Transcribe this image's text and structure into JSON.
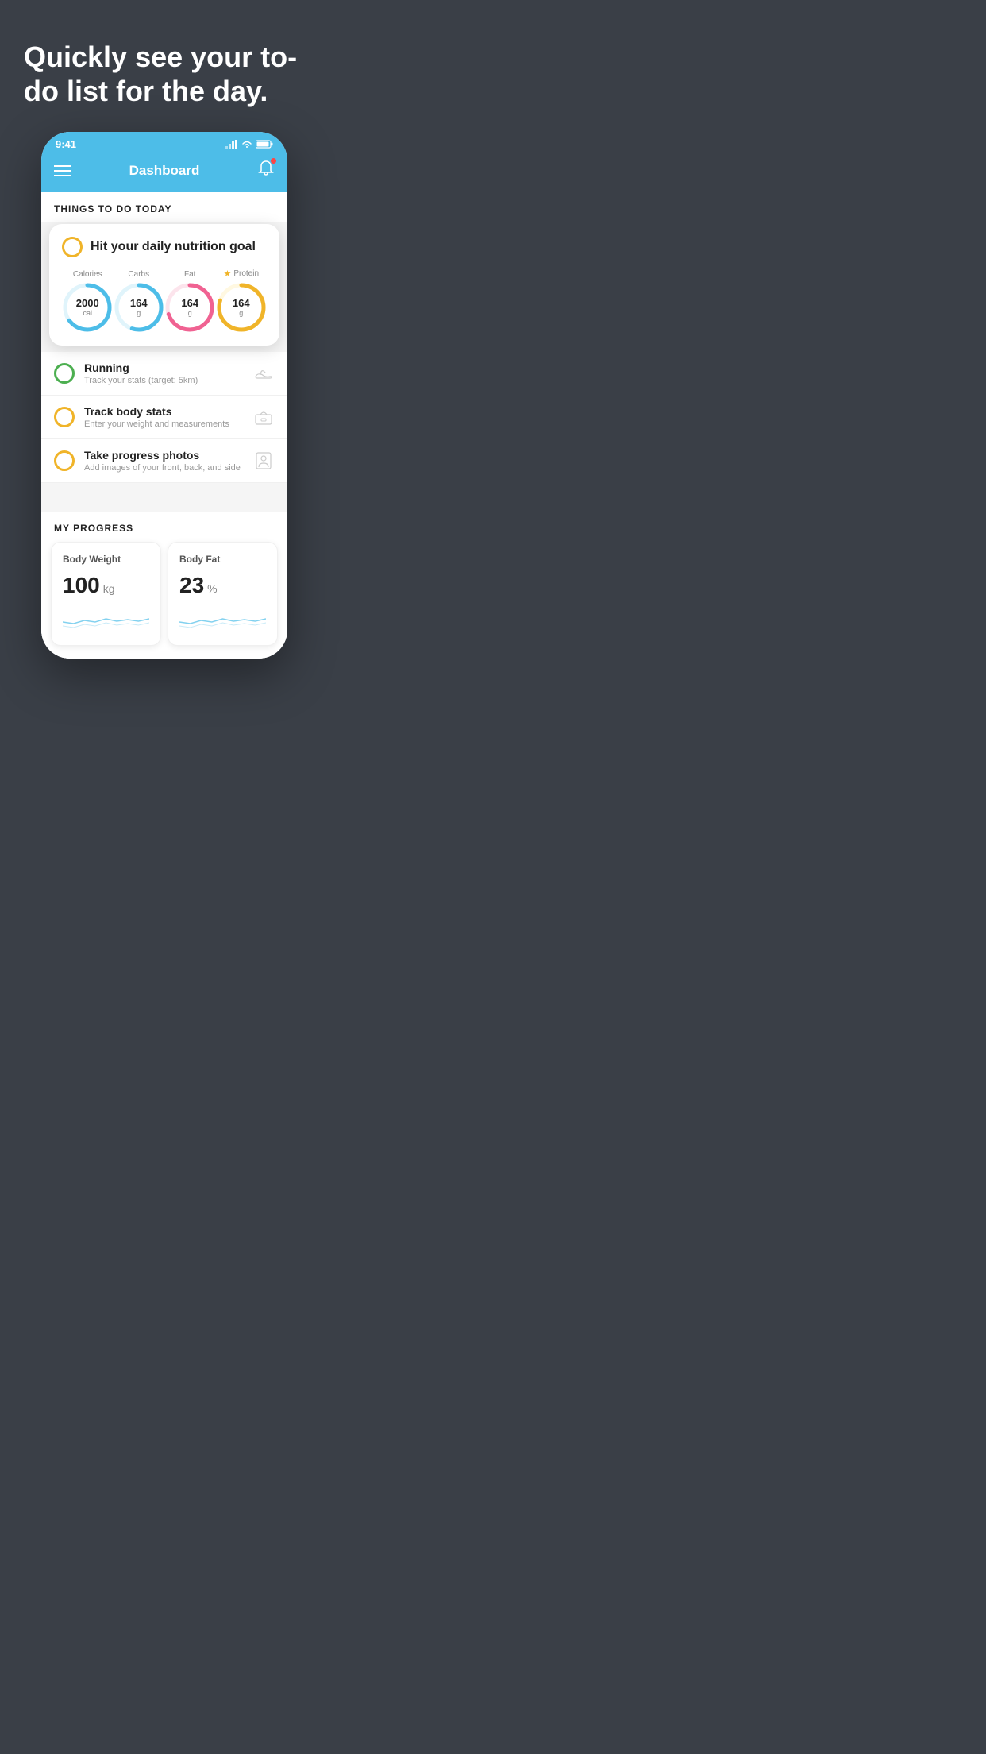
{
  "hero": {
    "title": "Quickly see your to-do list for the day."
  },
  "status_bar": {
    "time": "9:41",
    "signal": "▂▄▆█",
    "wifi": "wifi",
    "battery": "battery"
  },
  "header": {
    "title": "Dashboard"
  },
  "things_section": {
    "label": "THINGS TO DO TODAY"
  },
  "nutrition_card": {
    "title": "Hit your daily nutrition goal",
    "items": [
      {
        "label": "Calories",
        "value": "2000",
        "unit": "cal",
        "color": "#4dbde8",
        "track_color": "#e0f4fb",
        "percent": 65
      },
      {
        "label": "Carbs",
        "value": "164",
        "unit": "g",
        "color": "#4dbde8",
        "track_color": "#e0f4fb",
        "percent": 55
      },
      {
        "label": "Fat",
        "value": "164",
        "unit": "g",
        "color": "#f06292",
        "track_color": "#fce4ec",
        "percent": 70
      },
      {
        "label": "Protein",
        "value": "164",
        "unit": "g",
        "color": "#f0b429",
        "track_color": "#fff8e1",
        "percent": 80,
        "starred": true
      }
    ]
  },
  "todo_items": [
    {
      "title": "Running",
      "subtitle": "Track your stats (target: 5km)",
      "icon": "shoe",
      "checkbox_color": "#4caf50"
    },
    {
      "title": "Track body stats",
      "subtitle": "Enter your weight and measurements",
      "icon": "scale",
      "checkbox_color": "#f0b429"
    },
    {
      "title": "Take progress photos",
      "subtitle": "Add images of your front, back, and side",
      "icon": "person",
      "checkbox_color": "#f0b429"
    }
  ],
  "progress_section": {
    "label": "MY PROGRESS",
    "cards": [
      {
        "title": "Body Weight",
        "value": "100",
        "unit": "kg"
      },
      {
        "title": "Body Fat",
        "value": "23",
        "unit": "%"
      }
    ]
  }
}
